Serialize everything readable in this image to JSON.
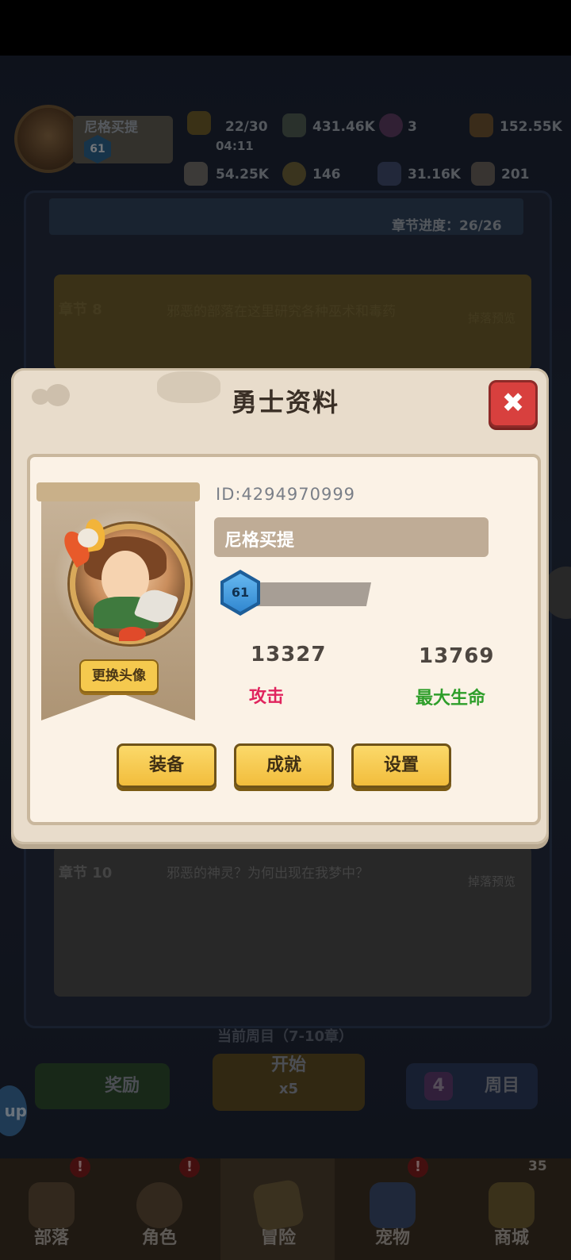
{
  "hud": {
    "player_name": "尼格买提",
    "level": "61",
    "energy": "22/30",
    "energy_timer": "04:11",
    "currency_1": "431.46K",
    "currency_2": "3",
    "currency_3": "152.55K",
    "currency_4": "54.25K",
    "currency_5": "146",
    "currency_6": "31.16K",
    "currency_7": "201"
  },
  "background": {
    "chapter_progress": "章节进度：26/26",
    "chapter_8_title": "章节 8",
    "chapter_8_desc": "邪恶的部落在这里研究各种巫术和毒药",
    "chapter_10_title": "章节 10",
    "chapter_10_desc": "邪恶的神灵？为何出现在我梦中？",
    "drop_preview": "掉落预览",
    "current_cycle": "当前周目（7-10章）",
    "reward_button": "奖励",
    "start_button": "开始",
    "start_cost": "x5",
    "cycle_number": "4",
    "cycle_button": "周目",
    "side_badge": "up"
  },
  "tabs": [
    {
      "label": "部落",
      "badge": "!"
    },
    {
      "label": "角色",
      "badge": "!"
    },
    {
      "label": "冒险",
      "badge": ""
    },
    {
      "label": "宠物",
      "badge": "!"
    },
    {
      "label": "商城",
      "badge": "35"
    }
  ],
  "dialog": {
    "title": "勇士资料",
    "close_icon": "✖",
    "change_avatar": "更换头像",
    "id_text": "ID:4294970999",
    "name": "尼格买提",
    "level": "61",
    "attack_value": "13327",
    "attack_label": "攻击",
    "hp_value": "13769",
    "hp_label": "最大生命",
    "equip_button": "装备",
    "achievement_button": "成就",
    "settings_button": "设置",
    "colors": {
      "attack": "#e0245e",
      "hp": "#2e9e2a",
      "button": "#f5c94e"
    }
  }
}
